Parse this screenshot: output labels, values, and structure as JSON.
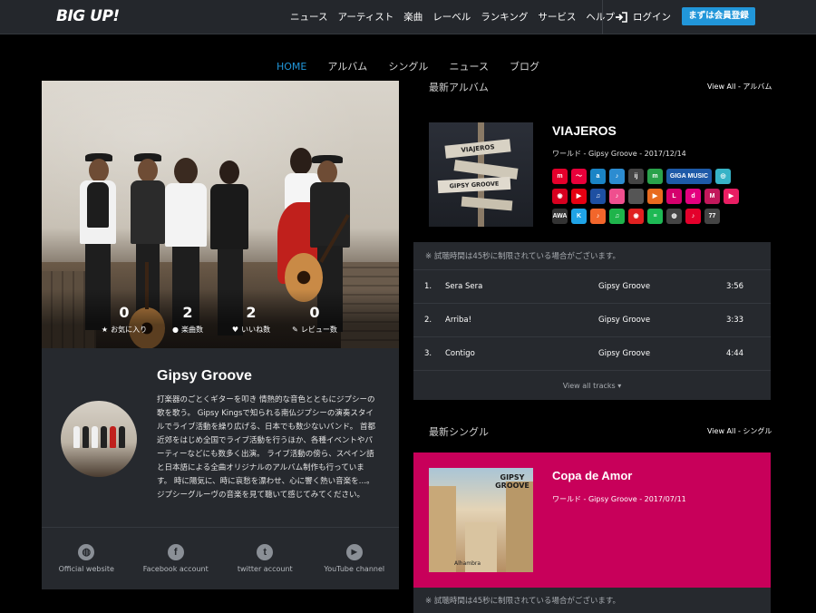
{
  "header": {
    "logo": "BIG UP!",
    "nav": [
      "ニュース",
      "アーティスト",
      "楽曲",
      "レーベル",
      "ランキング",
      "サービス",
      "ヘルプ"
    ],
    "login": "ログイン",
    "register": "まずは会員登録"
  },
  "tabs": [
    {
      "label": "HOME",
      "active": true
    },
    {
      "label": "アルバム",
      "active": false
    },
    {
      "label": "シングル",
      "active": false
    },
    {
      "label": "ニュース",
      "active": false
    },
    {
      "label": "ブログ",
      "active": false
    }
  ],
  "stats": [
    {
      "value": "0",
      "label": "お気に入り",
      "icon": "star-icon",
      "glyph": "★"
    },
    {
      "value": "2",
      "label": "楽曲数",
      "icon": "disc-icon",
      "glyph": "●"
    },
    {
      "value": "2",
      "label": "いいね数",
      "icon": "heart-icon",
      "glyph": "♥"
    },
    {
      "value": "0",
      "label": "レビュー数",
      "icon": "edit-icon",
      "glyph": "✎"
    }
  ],
  "artist": {
    "name": "Gipsy Groove",
    "bio": "打楽器のごとくギターを叩き 情熱的な音色とともにジプシーの歌を歌う。 Gipsy Kingsで知られる南仏ジプシーの演奏スタイルでライブ活動を繰り広げる、日本でも数少ないバンド。 首都近郊をはじめ全国でライブ活動を行うほか、各種イベントやパーティーなどにも数多く出演。 ライブ活動の傍ら、スペイン語と日本語による全曲オリジナルのアルバム制作も行っています。 時に陽気に、時に哀愁を漂わせ、心に響く熱い音楽を…。 ジプシーグルーヴの音楽を見て聴いて感じてみてください。"
  },
  "links": [
    {
      "label": "Official website",
      "icon": "globe-icon",
      "glyph": "◍"
    },
    {
      "label": "Facebook account",
      "icon": "facebook-icon",
      "glyph": "f"
    },
    {
      "label": "twitter account",
      "icon": "twitter-icon",
      "glyph": "t"
    },
    {
      "label": "YouTube channel",
      "icon": "youtube-icon",
      "glyph": "▶"
    }
  ],
  "latest_album": {
    "section_title": "最新アルバム",
    "view_all": "View All - アルバム",
    "title": "VIAJEROS",
    "meta": "ワールド - Gipsy Groove - 2017/12/14",
    "cover_sign1": "VIAJEROS",
    "cover_sign2": "GIPSY GROOVE",
    "services": [
      [
        {
          "text": "m",
          "color": "#e4002b"
        },
        {
          "text": "〜",
          "color": "#e9003a"
        },
        {
          "text": "a",
          "color": "#1a84c6"
        },
        {
          "text": "♪",
          "color": "#2c8cd1"
        },
        {
          "text": "ij",
          "color": "#444444"
        },
        {
          "text": "m",
          "color": "#2aa24b"
        },
        {
          "text": "GIGA MUSIC",
          "color": "#1e5aa8",
          "wide": true
        },
        {
          "text": "◎",
          "color": "#37b3c7"
        }
      ],
      [
        {
          "text": "◉",
          "color": "#d7001f"
        },
        {
          "text": "▶",
          "color": "#e60012"
        },
        {
          "text": "♫",
          "color": "#1e50a2"
        },
        {
          "text": "♪",
          "color": "#ef4f8e"
        },
        {
          "text": "",
          "color": "#555555"
        },
        {
          "text": "▶",
          "color": "#e86b1f"
        },
        {
          "text": "L",
          "color": "#d5006d"
        },
        {
          "text": "d",
          "color": "#e4007f"
        },
        {
          "text": "M",
          "color": "#c2185b"
        },
        {
          "text": "▶",
          "color": "#e91e63"
        }
      ],
      [
        {
          "text": "AWA",
          "color": "#333333"
        },
        {
          "text": "K",
          "color": "#1fa3e6"
        },
        {
          "text": "♪",
          "color": "#f2662b"
        },
        {
          "text": "♫",
          "color": "#1fb44b"
        },
        {
          "text": "◉",
          "color": "#e02020"
        },
        {
          "text": "≡",
          "color": "#1db954"
        },
        {
          "text": "◍",
          "color": "#444444"
        },
        {
          "text": "♪",
          "color": "#e4002b"
        },
        {
          "text": "77",
          "color": "#444444"
        }
      ]
    ]
  },
  "tracks": {
    "notice": "※ 試聴時間は45秒に制限されている場合がございます。",
    "rows": [
      {
        "no": "1.",
        "title": "Sera Sera",
        "artist": "Gipsy Groove",
        "time": "3:56"
      },
      {
        "no": "2.",
        "title": "Arriba!",
        "artist": "Gipsy Groove",
        "time": "3:33"
      },
      {
        "no": "3.",
        "title": "Contigo",
        "artist": "Gipsy Groove",
        "time": "4:44"
      }
    ],
    "view_all": "View all tracks ▾"
  },
  "latest_single": {
    "section_title": "最新シングル",
    "view_all": "View All - シングル",
    "title": "Copa de Amor",
    "meta": "ワールド - Gipsy Groove - 2017/07/11",
    "cover_text": "GIPSY GROOVE",
    "cover_caption": "Alhambra",
    "notice": "※ 試聴時間は45秒に制限されている場合がございます。"
  }
}
